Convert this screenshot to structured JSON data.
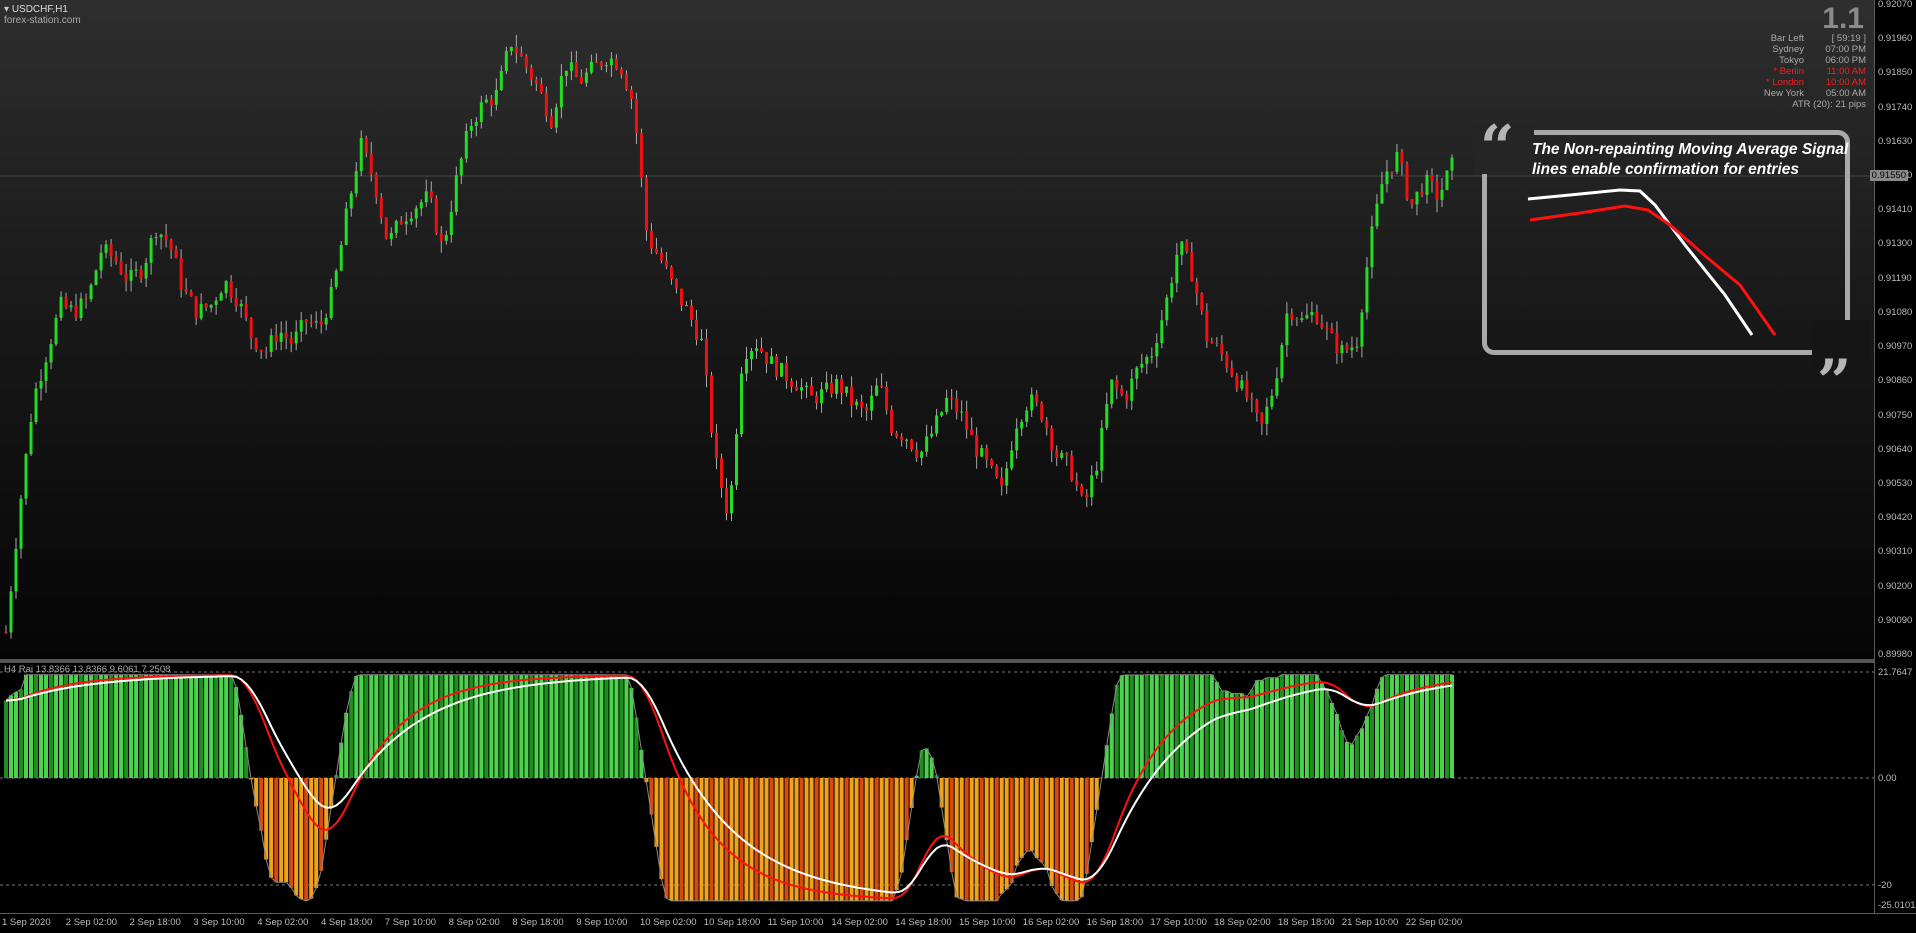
{
  "window": {
    "symbol": "USDCHF,H1",
    "site": "forex-station.com",
    "big_number": "1.1"
  },
  "info_panel": [
    {
      "label": "Bar Left",
      "value": "[ 59:19 ]",
      "highlight": false
    },
    {
      "label": "Sydney",
      "value": "07:00 PM",
      "highlight": false
    },
    {
      "label": "Tokyo",
      "value": "06:00 PM",
      "highlight": false
    },
    {
      "label": "* Berlin",
      "value": "11:00 AM",
      "highlight": true
    },
    {
      "label": "* London",
      "value": "10:00 AM",
      "highlight": true
    },
    {
      "label": "New York",
      "value": "05:00 AM",
      "highlight": false
    }
  ],
  "atr_text": "ATR (20): 21 pips",
  "current_price": "0.91550",
  "price_axis": [
    "0.92070",
    "0.91960",
    "0.91850",
    "0.91740",
    "0.91630",
    "0.91520",
    "0.91410",
    "0.91300",
    "0.91190",
    "0.91080",
    "0.90970",
    "0.90860",
    "0.90750",
    "0.90640",
    "0.90530",
    "0.90420",
    "0.90310",
    "0.90200",
    "0.90090",
    "0.89980"
  ],
  "indicator": {
    "title": "H4 Rai 13.8366 13.8366 9.6061 7.2508",
    "axis": [
      "21.7647",
      "0.00",
      "-20",
      "-25.0101"
    ]
  },
  "time_axis": [
    "1 Sep 2020",
    "2 Sep 02:00",
    "2 Sep 18:00",
    "3 Sep 10:00",
    "4 Sep 02:00",
    "4 Sep 18:00",
    "7 Sep 10:00",
    "8 Sep 02:00",
    "8 Sep 18:00",
    "9 Sep 10:00",
    "10 Sep 02:00",
    "10 Sep 18:00",
    "11 Sep 10:00",
    "14 Sep 02:00",
    "14 Sep 18:00",
    "15 Sep 10:00",
    "16 Sep 02:00",
    "16 Sep 18:00",
    "17 Sep 10:00",
    "18 Sep 02:00",
    "18 Sep 18:00",
    "21 Sep 10:00",
    "22 Sep 02:00"
  ],
  "callout": {
    "open_quote": "“",
    "close_quote": "„",
    "text": "The Non-repainting Moving Average Signal lines enable confirmation for entries"
  },
  "colors": {
    "bull": "#22dd22",
    "bear": "#ee1111",
    "hist_pos": "#33bb33",
    "hist_neg": "#e89a1a",
    "ma_white": "#ffffff",
    "ma_red": "#ff1111"
  },
  "chart_data": {
    "type": "candlestick",
    "description_note": "",
    "close_path": [
      0.9005,
      0.9045,
      0.908,
      0.9095,
      0.911,
      0.9108,
      0.9112,
      0.9128,
      0.9125,
      0.9118,
      0.9122,
      0.9135,
      0.913,
      0.9115,
      0.9108,
      0.911,
      0.9118,
      0.9112,
      0.91,
      0.9095,
      0.9102,
      0.9098,
      0.9105,
      0.9103,
      0.9115,
      0.914,
      0.9162,
      0.915,
      0.913,
      0.9138,
      0.9142,
      0.9145,
      0.9128,
      0.915,
      0.9168,
      0.9175,
      0.9178,
      0.9195,
      0.9188,
      0.918,
      0.917,
      0.9188,
      0.9182,
      0.9186,
      0.919,
      0.9188,
      0.9175,
      0.9132,
      0.9125,
      0.9115,
      0.9108,
      0.9098,
      0.906,
      0.9042,
      0.9095,
      0.9098,
      0.9092,
      0.9088,
      0.9085,
      0.908,
      0.9082,
      0.9085,
      0.9079,
      0.9075,
      0.9085,
      0.907,
      0.9068,
      0.9062,
      0.907,
      0.908,
      0.9075,
      0.9065,
      0.9058,
      0.905,
      0.9072,
      0.908,
      0.9075,
      0.9062,
      0.9058,
      0.9045,
      0.906,
      0.9085,
      0.908,
      0.909,
      0.9095,
      0.911,
      0.913,
      0.912,
      0.91,
      0.9095,
      0.9088,
      0.908,
      0.907,
      0.9085,
      0.911,
      0.9105,
      0.9108,
      0.91,
      0.9095,
      0.9098,
      0.913,
      0.9152,
      0.9158,
      0.9142,
      0.915,
      0.9145,
      0.9155
    ]
  }
}
